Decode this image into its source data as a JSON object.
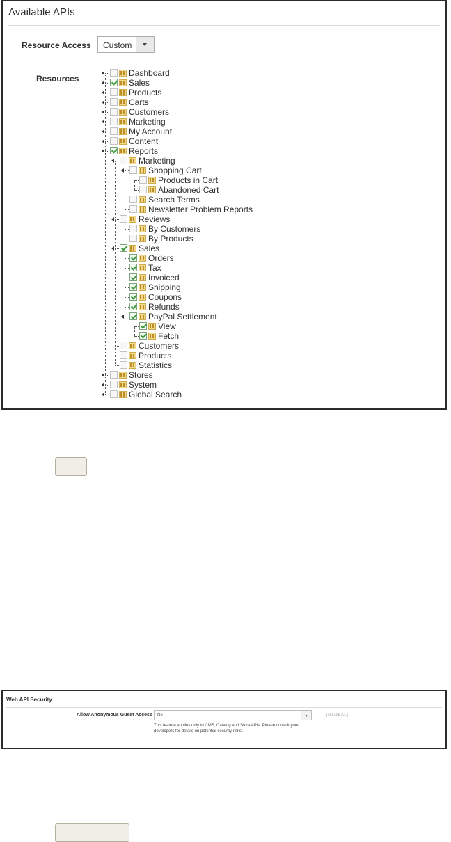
{
  "available_apis": {
    "title": "Available APIs",
    "resource_access_label": "Resource Access",
    "resource_access_value": "Custom",
    "resources_label": "Resources",
    "tree": [
      {
        "label": "Dashboard",
        "checked": false,
        "depth": 0
      },
      {
        "label": "Sales",
        "checked": true,
        "depth": 0
      },
      {
        "label": "Products",
        "checked": false,
        "depth": 0
      },
      {
        "label": "Carts",
        "checked": false,
        "depth": 0
      },
      {
        "label": "Customers",
        "checked": false,
        "depth": 0
      },
      {
        "label": "Marketing",
        "checked": false,
        "depth": 0
      },
      {
        "label": "My Account",
        "checked": false,
        "depth": 0
      },
      {
        "label": "Content",
        "checked": false,
        "depth": 0
      },
      {
        "label": "Reports",
        "checked": true,
        "depth": 0
      },
      {
        "label": "Marketing",
        "checked": false,
        "depth": 1
      },
      {
        "label": "Shopping Cart",
        "checked": false,
        "depth": 2
      },
      {
        "label": "Products in Cart",
        "checked": false,
        "depth": 3
      },
      {
        "label": "Abandoned Cart",
        "checked": false,
        "depth": 3
      },
      {
        "label": "Search Terms",
        "checked": false,
        "depth": 2
      },
      {
        "label": "Newsletter Problem Reports",
        "checked": false,
        "depth": 2
      },
      {
        "label": "Reviews",
        "checked": false,
        "depth": 1
      },
      {
        "label": "By Customers",
        "checked": false,
        "depth": 2
      },
      {
        "label": "By Products",
        "checked": false,
        "depth": 2
      },
      {
        "label": "Sales",
        "checked": true,
        "depth": 1
      },
      {
        "label": "Orders",
        "checked": true,
        "depth": 2
      },
      {
        "label": "Tax",
        "checked": true,
        "depth": 2
      },
      {
        "label": "Invoiced",
        "checked": true,
        "depth": 2
      },
      {
        "label": "Shipping",
        "checked": true,
        "depth": 2
      },
      {
        "label": "Coupons",
        "checked": true,
        "depth": 2
      },
      {
        "label": "Refunds",
        "checked": true,
        "depth": 2
      },
      {
        "label": "PayPal Settlement",
        "checked": true,
        "depth": 2
      },
      {
        "label": "View",
        "checked": true,
        "depth": 3
      },
      {
        "label": "Fetch",
        "checked": true,
        "depth": 3
      },
      {
        "label": "Customers",
        "checked": false,
        "depth": 1
      },
      {
        "label": "Products",
        "checked": false,
        "depth": 1
      },
      {
        "label": "Statistics",
        "checked": false,
        "depth": 1
      },
      {
        "label": "Stores",
        "checked": false,
        "depth": 0
      },
      {
        "label": "System",
        "checked": false,
        "depth": 0
      },
      {
        "label": "Global Search",
        "checked": false,
        "depth": 0
      }
    ]
  },
  "web_api_security": {
    "title": "Web API Security",
    "field_label": "Allow Anonymous Guest Access",
    "field_value": "No",
    "scope": "[GLOBAL]",
    "note": "This feature applies only to CMS, Catalog and Store APIs. Please consult your developers for details on potential security risks."
  }
}
